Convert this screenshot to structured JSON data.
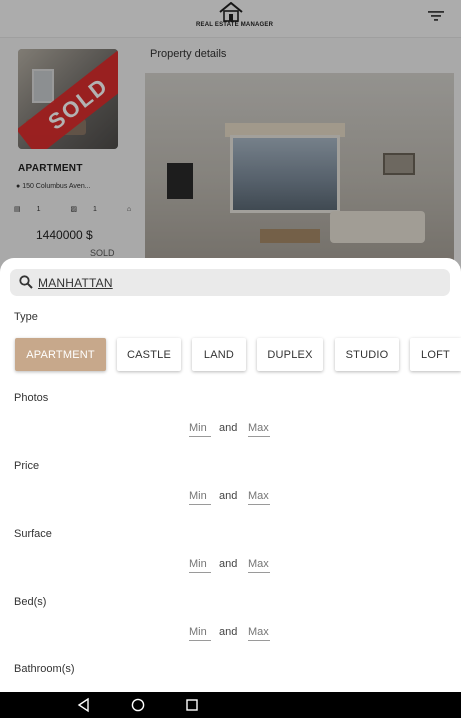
{
  "app": {
    "logo_text": "REAL ESTATE MANAGER",
    "filter_icon": "filter-icon"
  },
  "listing": {
    "badge": "SOLD",
    "type": "APARTMENT",
    "address": "150 Columbus Aven...",
    "rooms": "1",
    "bathrooms": "1",
    "bedrooms": "5",
    "price": "1440000 $",
    "status": "SOLD"
  },
  "details": {
    "title": "Property details"
  },
  "search": {
    "value": "MANHATTAN",
    "icon": "search-icon"
  },
  "filters": {
    "type_label": "Type",
    "types": [
      {
        "label": "APARTMENT",
        "selected": true
      },
      {
        "label": "CASTLE",
        "selected": false
      },
      {
        "label": "LAND",
        "selected": false
      },
      {
        "label": "DUPLEX",
        "selected": false
      },
      {
        "label": "STUDIO",
        "selected": false
      },
      {
        "label": "LOFT",
        "selected": false
      }
    ],
    "photos_label": "Photos",
    "price_label": "Price",
    "surface_label": "Surface",
    "beds_label": "Bed(s)",
    "bathrooms_label": "Bathroom(s)",
    "min_placeholder": "Min",
    "and_text": "and",
    "max_placeholder": "Max"
  },
  "colors": {
    "chip_selected": "#c7a88b",
    "sold_badge": "#e22b2b"
  },
  "navbar": {
    "icons": [
      "back-icon",
      "home-icon",
      "recents-icon"
    ]
  }
}
